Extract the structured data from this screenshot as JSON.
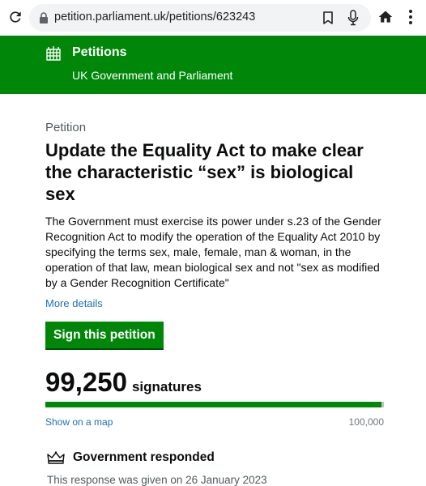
{
  "browser": {
    "url": "petition.parliament.uk/petitions/623243"
  },
  "header": {
    "title": "Petitions",
    "subtitle": "UK Government and Parliament"
  },
  "petition": {
    "eyebrow": "Petition",
    "title": "Update the Equality Act to make clear the characteristic “sex” is biological sex",
    "body": "The Government must exercise its power under s.23 of the Gender Recognition Act to modify the operation of the Equality Act 2010 by specifying the terms sex, male, female, man & woman, in the operation of that law, mean biological sex and not \"sex as modified by a Gender Recognition Certificate\"",
    "more_details": "More details",
    "sign_button": "Sign this petition"
  },
  "signatures": {
    "count": "99,250",
    "label": "signatures",
    "progress_fraction": 0.9925,
    "show_map": "Show on a map",
    "target": "100,000"
  },
  "response": {
    "heading": "Government responded",
    "date_text": "This response was given on 26 January 2023"
  },
  "colors": {
    "brand_green": "#00870a",
    "link_blue": "#1d70b8"
  }
}
